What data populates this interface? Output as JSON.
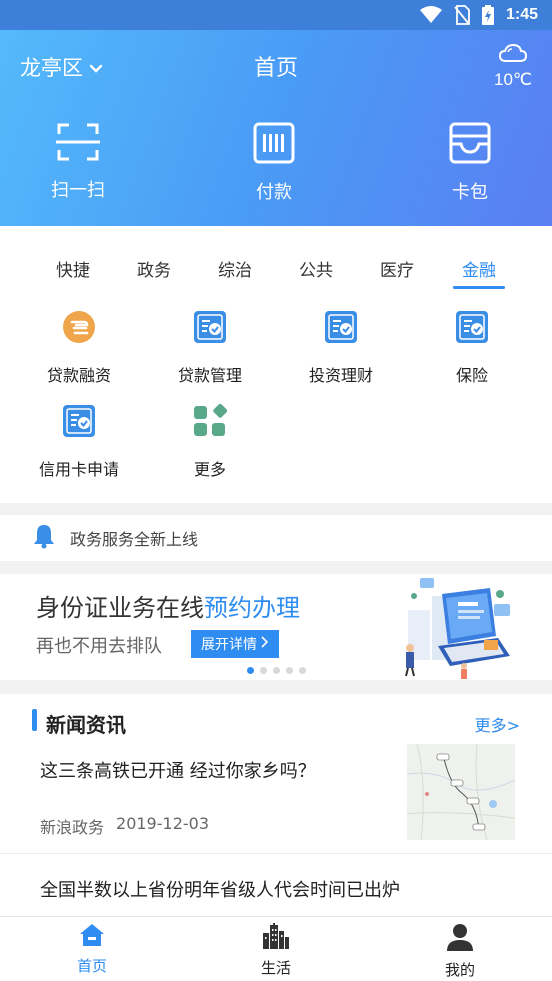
{
  "status_bar": {
    "time": "1:45",
    "icons": [
      "wifi-icon",
      "no-sim-icon",
      "battery-charging-icon"
    ]
  },
  "header": {
    "location": "龙亭区",
    "title": "首页",
    "weather": {
      "icon": "cloudy-icon",
      "temperature": "10℃"
    },
    "quick_actions": [
      {
        "label": "扫一扫",
        "icon": "scan-icon"
      },
      {
        "label": "付款",
        "icon": "barcode-pay-icon"
      },
      {
        "label": "卡包",
        "icon": "card-wallet-icon"
      }
    ]
  },
  "services": {
    "tabs": [
      "快捷",
      "政务",
      "综治",
      "公共",
      "医疗",
      "金融"
    ],
    "active_tab": "金融",
    "items": [
      {
        "label": "贷款融资",
        "icon": "loan-finance-icon"
      },
      {
        "label": "贷款管理",
        "icon": "loan-management-icon"
      },
      {
        "label": "投资理财",
        "icon": "investment-icon"
      },
      {
        "label": "保险",
        "icon": "insurance-icon"
      },
      {
        "label": "信用卡申请",
        "icon": "credit-card-application-icon"
      },
      {
        "label": "更多",
        "icon": "more-apps-icon"
      }
    ]
  },
  "notice": {
    "text": "政务服务全新上线",
    "icon": "bell-icon"
  },
  "banner": {
    "headline_main": "身份证业务在线",
    "headline_highlight": "预约办理",
    "subtitle": "再也不用去排队",
    "button_label": "展开详情",
    "slide_count": 5,
    "active_slide": 1
  },
  "news": {
    "section_title": "新闻资讯",
    "more_label": "更多>",
    "items": [
      {
        "title": "这三条高铁已开通 经过你家乡吗？",
        "source": "新浪政务",
        "date": "2019-12-03"
      },
      {
        "title": "全国半数以上省份明年省级人代会时间已出炉"
      }
    ]
  },
  "bottom_nav": {
    "items": [
      {
        "label": "首页",
        "icon": "home-icon"
      },
      {
        "label": "生活",
        "icon": "city-buildings-icon"
      },
      {
        "label": "我的",
        "icon": "user-profile-icon"
      }
    ],
    "active": "首页"
  },
  "colors": {
    "accent": "#2f8cf0",
    "header_start": "#54b9fb",
    "header_end": "#5a7ff2",
    "loan_icon": "#f0a54a",
    "more_icon": "#5aa88a"
  }
}
